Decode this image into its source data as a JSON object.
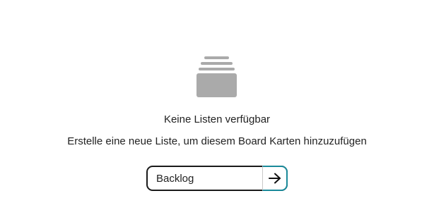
{
  "empty_state": {
    "icon": "card-stack-icon",
    "title": "Keine Listen verfügbar",
    "subtitle": "Erstelle eine neue Liste, um diesem Board Karten hinzuzufügen",
    "icon_color": "#aaaaaa"
  },
  "new_list": {
    "value": "Backlog",
    "submit_icon": "arrow-right-icon",
    "accent_color": "#1a8a9a"
  }
}
